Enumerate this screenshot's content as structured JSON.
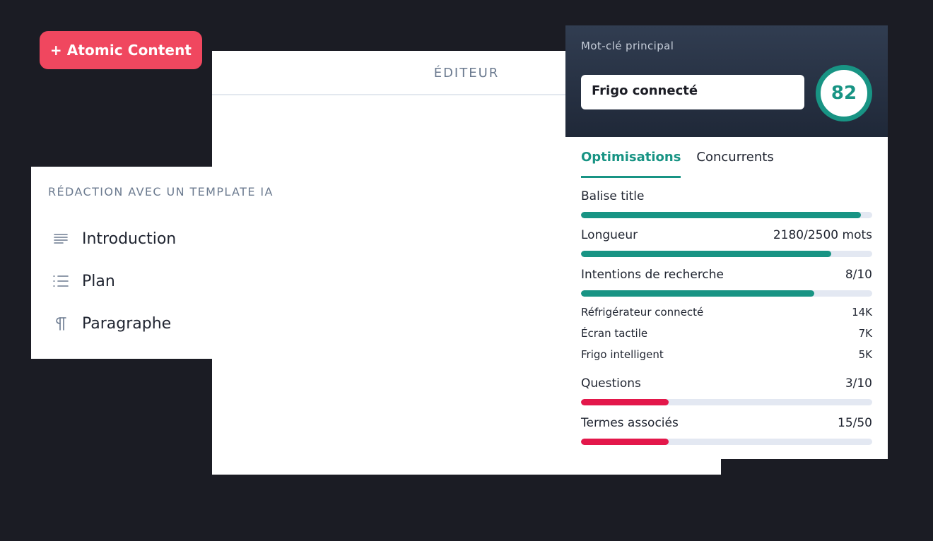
{
  "atomic_button": {
    "label": "+ Atomic Content"
  },
  "editor": {
    "title": "ÉDITEUR"
  },
  "template_panel": {
    "heading": "RÉDACTION AVEC UN TEMPLATE IA",
    "items": [
      {
        "label": "Introduction",
        "icon": "align-left-icon"
      },
      {
        "label": "Plan",
        "icon": "list-icon"
      },
      {
        "label": "Paragraphe",
        "icon": "pilcrow-icon"
      }
    ]
  },
  "seo": {
    "keyword_label": "Mot-clé principal",
    "keyword_value": "Frigo connecté",
    "score": "82",
    "tabs": [
      {
        "label": "Optimisations",
        "active": true
      },
      {
        "label": "Concurrents",
        "active": false
      }
    ],
    "metrics": [
      {
        "label": "Balise title",
        "value": "",
        "progress": 0.96,
        "color": "#189484"
      },
      {
        "label": "Longueur",
        "value": "2180/2500 mots",
        "progress": 0.86,
        "color": "#189484"
      },
      {
        "label": "Intentions de recherche",
        "value": "8/10",
        "progress": 0.8,
        "color": "#189484",
        "sub": [
          {
            "label": "Réfrigérateur connecté",
            "value": "14K"
          },
          {
            "label": "Écran tactile",
            "value": "7K"
          },
          {
            "label": "Frigo intelligent",
            "value": "5K"
          }
        ]
      },
      {
        "label": "Questions",
        "value": "3/10",
        "progress": 0.3,
        "color": "#e3174a"
      },
      {
        "label": "Termes associés",
        "value": "15/50",
        "progress": 0.3,
        "color": "#e3174a"
      }
    ]
  },
  "colors": {
    "accent": "#189484",
    "danger": "#e3174a",
    "brand": "#f0475f",
    "background": "#1b1c24"
  }
}
